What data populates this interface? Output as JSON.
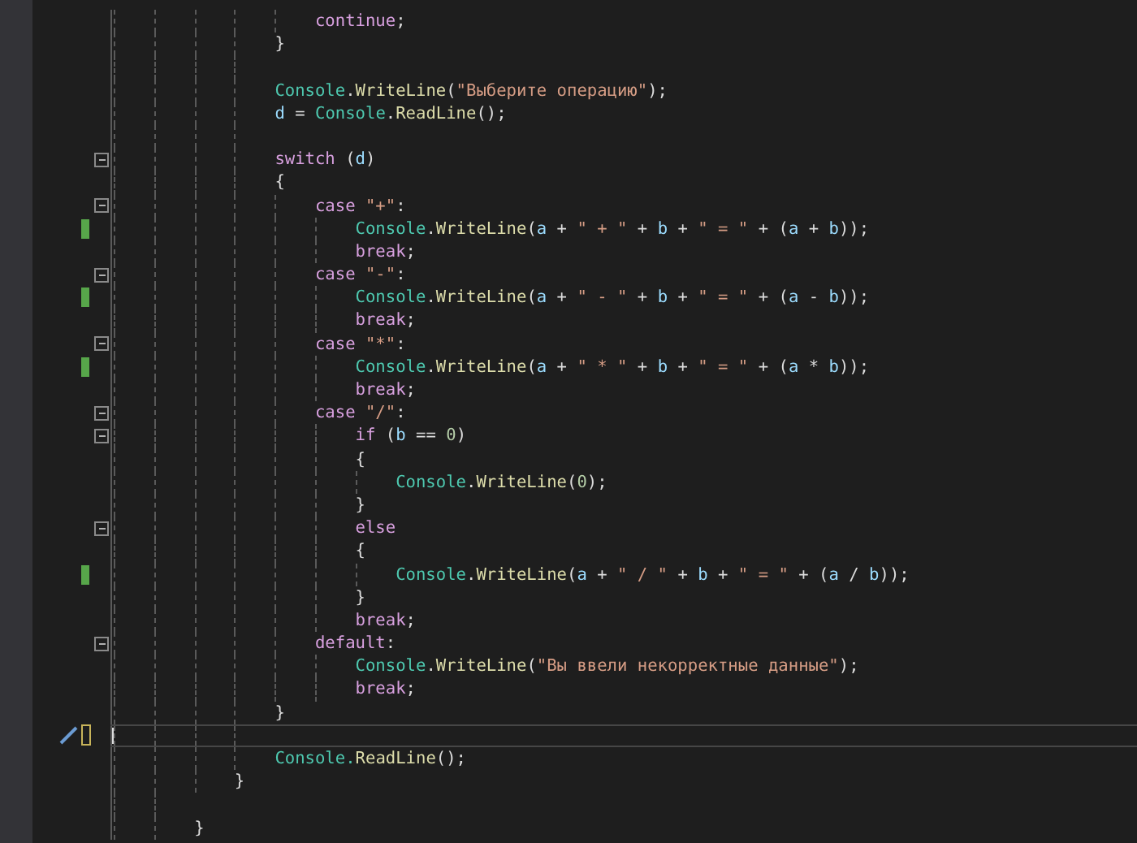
{
  "editor": {
    "lines": [
      {
        "fold": false,
        "changed": false,
        "unsaved": false,
        "current": false,
        "actions": false,
        "tokens": [
          {
            "kind": "keyword",
            "text": "                    continue"
          },
          {
            "kind": "plain",
            "text": ";"
          }
        ]
      },
      {
        "fold": false,
        "changed": false,
        "unsaved": false,
        "current": false,
        "actions": false,
        "tokens": [
          {
            "kind": "plain",
            "text": "                }"
          }
        ]
      },
      {
        "fold": false,
        "changed": false,
        "unsaved": false,
        "current": false,
        "actions": false
      },
      {
        "fold": false,
        "changed": false,
        "unsaved": false,
        "current": false,
        "actions": false,
        "tokens": [
          {
            "kind": "type",
            "text": "                Console"
          },
          {
            "kind": "plain",
            "text": "."
          },
          {
            "kind": "method",
            "text": "WriteLine"
          },
          {
            "kind": "plain",
            "text": "("
          },
          {
            "kind": "string",
            "text": "\"Выберите операцию\""
          },
          {
            "kind": "plain",
            "text": ");"
          }
        ]
      },
      {
        "fold": false,
        "changed": false,
        "unsaved": false,
        "current": false,
        "actions": false,
        "tokens": [
          {
            "kind": "variable",
            "text": "                d"
          },
          {
            "kind": "plain",
            "text": " = "
          },
          {
            "kind": "type",
            "text": "Console"
          },
          {
            "kind": "plain",
            "text": "."
          },
          {
            "kind": "method",
            "text": "ReadLine"
          },
          {
            "kind": "plain",
            "text": "();"
          }
        ]
      },
      {
        "fold": false,
        "changed": false,
        "unsaved": false,
        "current": false,
        "actions": false
      },
      {
        "fold": true,
        "changed": false,
        "unsaved": false,
        "current": false,
        "actions": false,
        "tokens": [
          {
            "kind": "keyword",
            "text": "                switch"
          },
          {
            "kind": "plain",
            "text": " ("
          },
          {
            "kind": "variable",
            "text": "d"
          },
          {
            "kind": "plain",
            "text": ")"
          }
        ]
      },
      {
        "fold": false,
        "changed": false,
        "unsaved": false,
        "current": false,
        "actions": false,
        "tokens": [
          {
            "kind": "plain",
            "text": "                {"
          }
        ]
      },
      {
        "fold": true,
        "changed": false,
        "unsaved": false,
        "current": false,
        "actions": false,
        "tokens": [
          {
            "kind": "keyword",
            "text": "                    case "
          },
          {
            "kind": "string",
            "text": "\"+\""
          },
          {
            "kind": "plain",
            "text": ":"
          }
        ]
      },
      {
        "fold": false,
        "changed": true,
        "unsaved": false,
        "current": false,
        "actions": false,
        "tokens": [
          {
            "kind": "type",
            "text": "                        Console"
          },
          {
            "kind": "plain",
            "text": "."
          },
          {
            "kind": "method",
            "text": "WriteLine"
          },
          {
            "kind": "plain",
            "text": "("
          },
          {
            "kind": "variable",
            "text": "a"
          },
          {
            "kind": "plain",
            "text": " + "
          },
          {
            "kind": "string",
            "text": "\" + \""
          },
          {
            "kind": "plain",
            "text": " + "
          },
          {
            "kind": "variable",
            "text": "b"
          },
          {
            "kind": "plain",
            "text": " + "
          },
          {
            "kind": "string",
            "text": "\" = \""
          },
          {
            "kind": "plain",
            "text": " + ("
          },
          {
            "kind": "variable",
            "text": "a"
          },
          {
            "kind": "plain",
            "text": " + "
          },
          {
            "kind": "variable",
            "text": "b"
          },
          {
            "kind": "plain",
            "text": "));"
          }
        ]
      },
      {
        "fold": false,
        "changed": false,
        "unsaved": false,
        "current": false,
        "actions": false,
        "tokens": [
          {
            "kind": "keyword",
            "text": "                        break"
          },
          {
            "kind": "plain",
            "text": ";"
          }
        ]
      },
      {
        "fold": true,
        "changed": false,
        "unsaved": false,
        "current": false,
        "actions": false,
        "tokens": [
          {
            "kind": "keyword",
            "text": "                    case "
          },
          {
            "kind": "string",
            "text": "\"-\""
          },
          {
            "kind": "plain",
            "text": ":"
          }
        ]
      },
      {
        "fold": false,
        "changed": true,
        "unsaved": false,
        "current": false,
        "actions": false,
        "tokens": [
          {
            "kind": "type",
            "text": "                        Console"
          },
          {
            "kind": "plain",
            "text": "."
          },
          {
            "kind": "method",
            "text": "WriteLine"
          },
          {
            "kind": "plain",
            "text": "("
          },
          {
            "kind": "variable",
            "text": "a"
          },
          {
            "kind": "plain",
            "text": " + "
          },
          {
            "kind": "string",
            "text": "\" - \""
          },
          {
            "kind": "plain",
            "text": " + "
          },
          {
            "kind": "variable",
            "text": "b"
          },
          {
            "kind": "plain",
            "text": " + "
          },
          {
            "kind": "string",
            "text": "\" = \""
          },
          {
            "kind": "plain",
            "text": " + ("
          },
          {
            "kind": "variable",
            "text": "a"
          },
          {
            "kind": "plain",
            "text": " - "
          },
          {
            "kind": "variable",
            "text": "b"
          },
          {
            "kind": "plain",
            "text": "));"
          }
        ]
      },
      {
        "fold": false,
        "changed": false,
        "unsaved": false,
        "current": false,
        "actions": false,
        "tokens": [
          {
            "kind": "keyword",
            "text": "                        break"
          },
          {
            "kind": "plain",
            "text": ";"
          }
        ]
      },
      {
        "fold": true,
        "changed": false,
        "unsaved": false,
        "current": false,
        "actions": false,
        "tokens": [
          {
            "kind": "keyword",
            "text": "                    case "
          },
          {
            "kind": "string",
            "text": "\"*\""
          },
          {
            "kind": "plain",
            "text": ":"
          }
        ]
      },
      {
        "fold": false,
        "changed": true,
        "unsaved": false,
        "current": false,
        "actions": false,
        "tokens": [
          {
            "kind": "type",
            "text": "                        Console"
          },
          {
            "kind": "plain",
            "text": "."
          },
          {
            "kind": "method",
            "text": "WriteLine"
          },
          {
            "kind": "plain",
            "text": "("
          },
          {
            "kind": "variable",
            "text": "a"
          },
          {
            "kind": "plain",
            "text": " + "
          },
          {
            "kind": "string",
            "text": "\" * \""
          },
          {
            "kind": "plain",
            "text": " + "
          },
          {
            "kind": "variable",
            "text": "b"
          },
          {
            "kind": "plain",
            "text": " + "
          },
          {
            "kind": "string",
            "text": "\" = \""
          },
          {
            "kind": "plain",
            "text": " + ("
          },
          {
            "kind": "variable",
            "text": "a"
          },
          {
            "kind": "plain",
            "text": " * "
          },
          {
            "kind": "variable",
            "text": "b"
          },
          {
            "kind": "plain",
            "text": "));"
          }
        ]
      },
      {
        "fold": false,
        "changed": false,
        "unsaved": false,
        "current": false,
        "actions": false,
        "tokens": [
          {
            "kind": "keyword",
            "text": "                        break"
          },
          {
            "kind": "plain",
            "text": ";"
          }
        ]
      },
      {
        "fold": true,
        "changed": false,
        "unsaved": false,
        "current": false,
        "actions": false,
        "tokens": [
          {
            "kind": "keyword",
            "text": "                    case "
          },
          {
            "kind": "string",
            "text": "\"/\""
          },
          {
            "kind": "plain",
            "text": ":"
          }
        ]
      },
      {
        "fold": true,
        "changed": false,
        "unsaved": false,
        "current": false,
        "actions": false,
        "tokens": [
          {
            "kind": "keyword",
            "text": "                        if"
          },
          {
            "kind": "plain",
            "text": " ("
          },
          {
            "kind": "variable",
            "text": "b"
          },
          {
            "kind": "plain",
            "text": " == "
          },
          {
            "kind": "number",
            "text": "0"
          },
          {
            "kind": "plain",
            "text": ")"
          }
        ]
      },
      {
        "fold": false,
        "changed": false,
        "unsaved": false,
        "current": false,
        "actions": false,
        "tokens": [
          {
            "kind": "plain",
            "text": "                        {"
          }
        ]
      },
      {
        "fold": false,
        "changed": false,
        "unsaved": false,
        "current": false,
        "actions": false,
        "tokens": [
          {
            "kind": "type",
            "text": "                            Console"
          },
          {
            "kind": "plain",
            "text": "."
          },
          {
            "kind": "method",
            "text": "WriteLine"
          },
          {
            "kind": "plain",
            "text": "("
          },
          {
            "kind": "number",
            "text": "0"
          },
          {
            "kind": "plain",
            "text": ");"
          }
        ]
      },
      {
        "fold": false,
        "changed": false,
        "unsaved": false,
        "current": false,
        "actions": false,
        "tokens": [
          {
            "kind": "plain",
            "text": "                        }"
          }
        ]
      },
      {
        "fold": true,
        "changed": false,
        "unsaved": false,
        "current": false,
        "actions": false,
        "tokens": [
          {
            "kind": "keyword",
            "text": "                        else"
          }
        ]
      },
      {
        "fold": false,
        "changed": false,
        "unsaved": false,
        "current": false,
        "actions": false,
        "tokens": [
          {
            "kind": "plain",
            "text": "                        {"
          }
        ]
      },
      {
        "fold": false,
        "changed": true,
        "unsaved": false,
        "current": false,
        "actions": false,
        "tokens": [
          {
            "kind": "type",
            "text": "                            Console"
          },
          {
            "kind": "plain",
            "text": "."
          },
          {
            "kind": "method",
            "text": "WriteLine"
          },
          {
            "kind": "plain",
            "text": "("
          },
          {
            "kind": "variable",
            "text": "a"
          },
          {
            "kind": "plain",
            "text": " + "
          },
          {
            "kind": "string",
            "text": "\" / \""
          },
          {
            "kind": "plain",
            "text": " + "
          },
          {
            "kind": "variable",
            "text": "b"
          },
          {
            "kind": "plain",
            "text": " + "
          },
          {
            "kind": "string",
            "text": "\" = \""
          },
          {
            "kind": "plain",
            "text": " + ("
          },
          {
            "kind": "variable",
            "text": "a"
          },
          {
            "kind": "plain",
            "text": " / "
          },
          {
            "kind": "variable",
            "text": "b"
          },
          {
            "kind": "plain",
            "text": "));"
          }
        ]
      },
      {
        "fold": false,
        "changed": false,
        "unsaved": false,
        "current": false,
        "actions": false,
        "tokens": [
          {
            "kind": "plain",
            "text": "                        }"
          }
        ]
      },
      {
        "fold": false,
        "changed": false,
        "unsaved": false,
        "current": false,
        "actions": false,
        "tokens": [
          {
            "kind": "keyword",
            "text": "                        break"
          },
          {
            "kind": "plain",
            "text": ";"
          }
        ]
      },
      {
        "fold": true,
        "changed": false,
        "unsaved": false,
        "current": false,
        "actions": false,
        "tokens": [
          {
            "kind": "keyword",
            "text": "                    default"
          },
          {
            "kind": "plain",
            "text": ":"
          }
        ]
      },
      {
        "fold": false,
        "changed": false,
        "unsaved": false,
        "current": false,
        "actions": false,
        "tokens": [
          {
            "kind": "type",
            "text": "                        Console"
          },
          {
            "kind": "plain",
            "text": "."
          },
          {
            "kind": "method",
            "text": "WriteLine"
          },
          {
            "kind": "plain",
            "text": "("
          },
          {
            "kind": "string",
            "text": "\"Вы ввели некорректные данные\""
          },
          {
            "kind": "plain",
            "text": ");"
          }
        ]
      },
      {
        "fold": false,
        "changed": false,
        "unsaved": false,
        "current": false,
        "actions": false,
        "tokens": [
          {
            "kind": "keyword",
            "text": "                        break"
          },
          {
            "kind": "plain",
            "text": ";"
          }
        ]
      },
      {
        "fold": false,
        "changed": false,
        "unsaved": false,
        "current": false,
        "actions": false,
        "tokens": [
          {
            "kind": "plain",
            "text": "                }"
          }
        ]
      },
      {
        "fold": false,
        "changed": false,
        "unsaved": true,
        "current": true,
        "actions": true
      },
      {
        "fold": false,
        "changed": false,
        "unsaved": false,
        "current": false,
        "actions": false,
        "tokens": [
          {
            "kind": "type",
            "text": "                Console."
          },
          {
            "kind": "method",
            "text": "ReadLine"
          },
          {
            "kind": "plain",
            "text": "();"
          }
        ]
      },
      {
        "fold": false,
        "changed": false,
        "unsaved": false,
        "current": false,
        "actions": false,
        "tokens": [
          {
            "kind": "plain",
            "text": "            }"
          }
        ]
      },
      {
        "fold": false,
        "changed": false,
        "unsaved": false,
        "current": false,
        "actions": false
      },
      {
        "fold": false,
        "changed": false,
        "unsaved": false,
        "current": false,
        "actions": false,
        "tokens": [
          {
            "kind": "plain",
            "text": "        }"
          }
        ]
      }
    ]
  }
}
